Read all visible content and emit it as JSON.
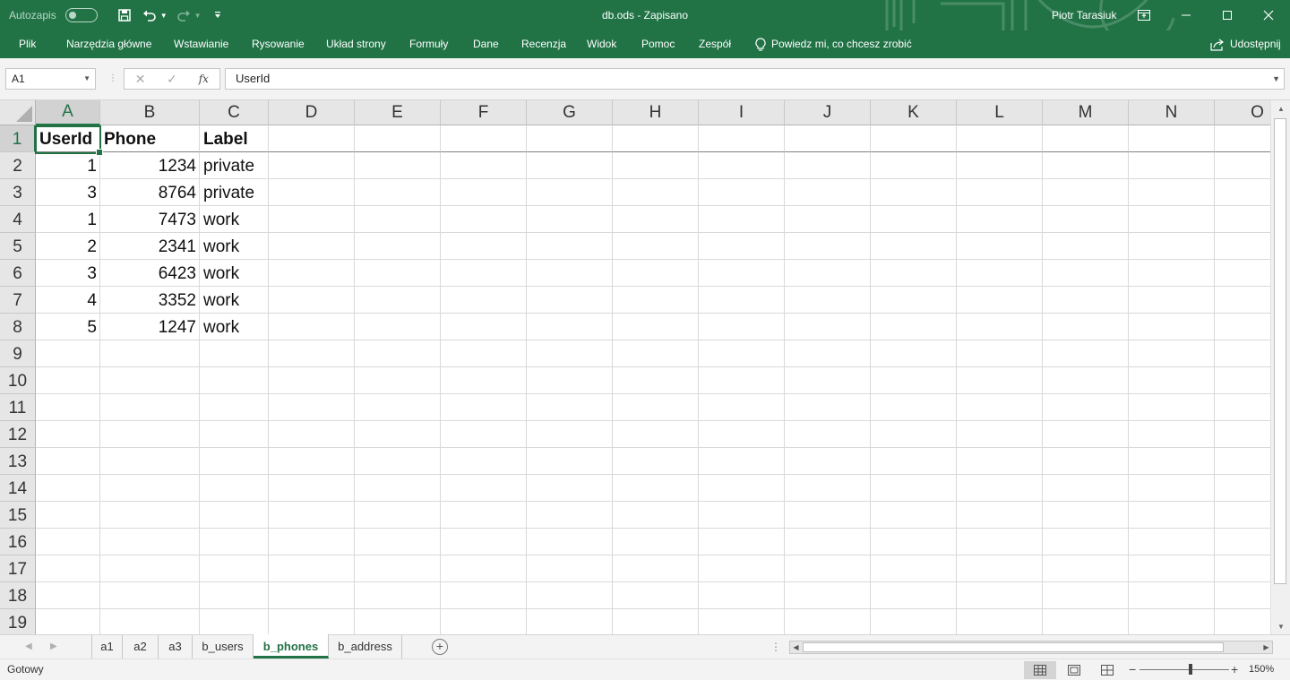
{
  "titlebar": {
    "autosave_label": "Autozapis",
    "document_title": "db.ods  -  Zapisano",
    "user_name": "Piotr Tarasiuk",
    "icons": [
      "save-icon",
      "undo-icon",
      "redo-icon",
      "customize-qat-icon",
      "ribbon-display-icon",
      "minimize-icon",
      "maximize-icon",
      "close-icon"
    ]
  },
  "ribbon": {
    "tabs": [
      "Plik",
      "Narzędzia główne",
      "Wstawianie",
      "Rysowanie",
      "Układ strony",
      "Formuły",
      "Dane",
      "Recenzja",
      "Widok",
      "Pomoc",
      "Zespół"
    ],
    "tell_me": "Powiedz mi, co chcesz zrobić",
    "share": "Udostępnij"
  },
  "formula_bar": {
    "name_box": "A1",
    "fx_label": "fx",
    "content": "UserId"
  },
  "sheet": {
    "columns": [
      "A",
      "B",
      "C",
      "D",
      "E",
      "F",
      "G",
      "H",
      "I",
      "J",
      "K",
      "L",
      "M",
      "N",
      "O"
    ],
    "rows": [
      "1",
      "2",
      "3",
      "4",
      "5",
      "6",
      "7",
      "8",
      "9",
      "10",
      "11",
      "12",
      "13",
      "14",
      "15",
      "16",
      "17",
      "18",
      "19"
    ],
    "header": [
      "UserId",
      "Phone",
      "Label"
    ],
    "data": [
      [
        "1",
        "1234",
        "private"
      ],
      [
        "3",
        "8764",
        "private"
      ],
      [
        "1",
        "7473",
        "work"
      ],
      [
        "2",
        "2341",
        "work"
      ],
      [
        "3",
        "6423",
        "work"
      ],
      [
        "4",
        "3352",
        "work"
      ],
      [
        "5",
        "1247",
        "work"
      ]
    ],
    "selected_cell": "A1"
  },
  "sheet_tabs": {
    "tabs": [
      "a1",
      "a2",
      "a3",
      "b_users",
      "b_phones",
      "b_address"
    ],
    "active": "b_phones"
  },
  "status_bar": {
    "status": "Gotowy",
    "zoom": "150%",
    "zoom_percent": 150
  },
  "colors": {
    "accent": "#217346",
    "gridline": "#d9d9d9",
    "header_bg": "#e6e6e6"
  }
}
